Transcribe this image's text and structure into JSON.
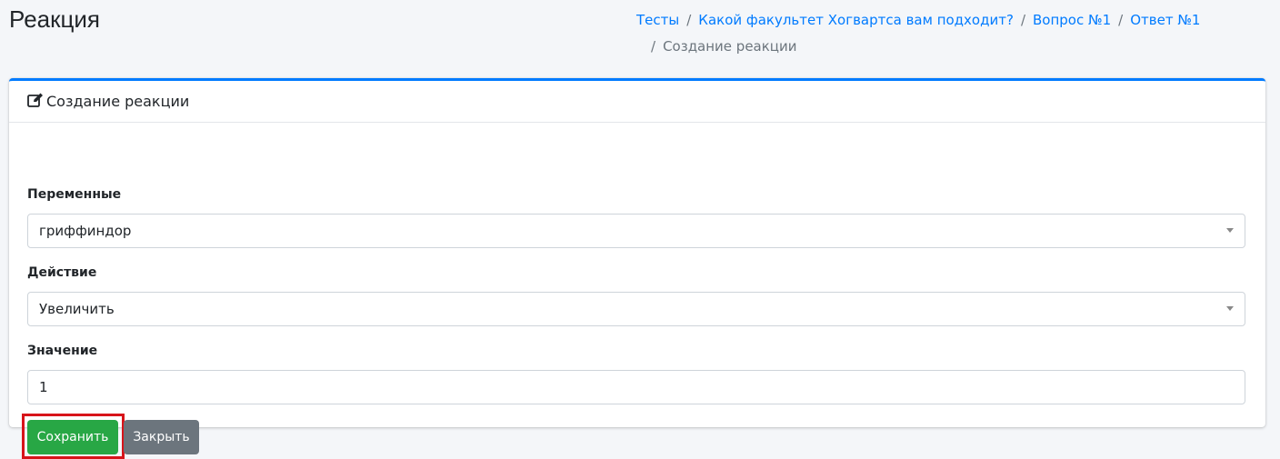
{
  "header": {
    "title": "Реакция"
  },
  "breadcrumb": {
    "items": [
      "Тесты",
      "Какой факультет Хогвартса вам подходит?",
      "Вопрос №1",
      "Ответ №1"
    ],
    "separator": "/",
    "active": "Создание реакции"
  },
  "card": {
    "title": "Создание реакции",
    "icon": "edit-icon",
    "accent": "#007bff"
  },
  "form": {
    "variables": {
      "label": "Переменные",
      "value": "гриффиндор"
    },
    "action": {
      "label": "Действие",
      "value": "Увеличить"
    },
    "amount": {
      "label": "Значение",
      "value": "1"
    }
  },
  "buttons": {
    "save": {
      "label": "Сохранить",
      "color": "#28a745"
    },
    "close": {
      "label": "Закрыть",
      "color": "#6c757d"
    }
  },
  "highlight_color": "#d7141a"
}
